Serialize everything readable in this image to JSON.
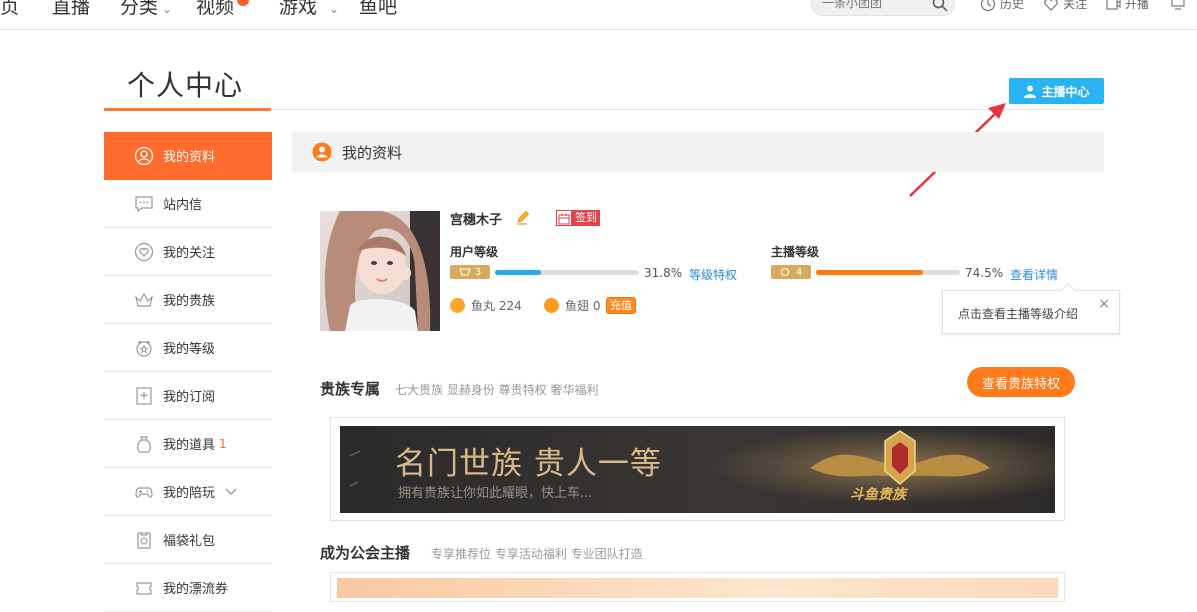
{
  "nav": {
    "items": [
      {
        "label": "页"
      },
      {
        "label": "直播"
      },
      {
        "label": "分类"
      },
      {
        "label": "视频"
      },
      {
        "label": "游戏"
      },
      {
        "label": "鱼吧"
      }
    ],
    "search_placeholder": "一条小团团",
    "right": {
      "history": "历史",
      "follow": "关注",
      "broadcast": "开播"
    }
  },
  "page": {
    "title": "个人中心",
    "anchor_center_btn": "主播中心"
  },
  "sidebar": {
    "items": [
      {
        "label": "我的资料",
        "icon": "user-circle-icon"
      },
      {
        "label": "站内信",
        "icon": "message-icon"
      },
      {
        "label": "我的关注",
        "icon": "heart-icon"
      },
      {
        "label": "我的贵族",
        "icon": "crown-icon"
      },
      {
        "label": "我的等级",
        "icon": "level-icon"
      },
      {
        "label": "我的订阅",
        "icon": "subscribe-icon"
      },
      {
        "label": "我的道具",
        "icon": "bag-icon",
        "badge": "1"
      },
      {
        "label": "我的陪玩",
        "icon": "gamepad-icon"
      },
      {
        "label": "福袋礼包",
        "icon": "gift-bag-icon"
      },
      {
        "label": "我的漂流券",
        "icon": "ticket-icon"
      }
    ]
  },
  "profile": {
    "section_title": "我的资料",
    "username": "宫穗木子",
    "signin": "签到",
    "user_level": {
      "label": "用户等级",
      "level": "3",
      "progress": 31.8,
      "pct_text": "31.8%",
      "link": "等级特权"
    },
    "anchor_level": {
      "label": "主播等级",
      "level": "4",
      "progress": 74.5,
      "pct_text": "74.5%",
      "link": "查看详情"
    },
    "fish_ball": "鱼丸 224",
    "fish_fin": "鱼翅 0",
    "recharge": "充值",
    "tooltip": "点击查看主播等级介绍",
    "tooltip_close": "×"
  },
  "noble": {
    "title": "贵族专属",
    "desc": "七大贵族 显赫身份 尊贵特权 奢华福利",
    "button": "查看贵族特权",
    "banner_headline": "名门世族 贵人一等",
    "banner_sub": "拥有贵族让你如此耀眼，快上车...",
    "banner_logo": "斗鱼贵族"
  },
  "guild": {
    "title": "成为公会主播",
    "desc": "专享推荐位 专享活动福利 专业团队打造"
  },
  "colors": {
    "accent": "#ff6c2d",
    "anchor_btn": "#2ab3f2",
    "user_bar": "#29aaf0",
    "anchor_bar": "#ff7a0e",
    "link": "#2a8ed9",
    "annotation_arrow": "#e8323c"
  }
}
